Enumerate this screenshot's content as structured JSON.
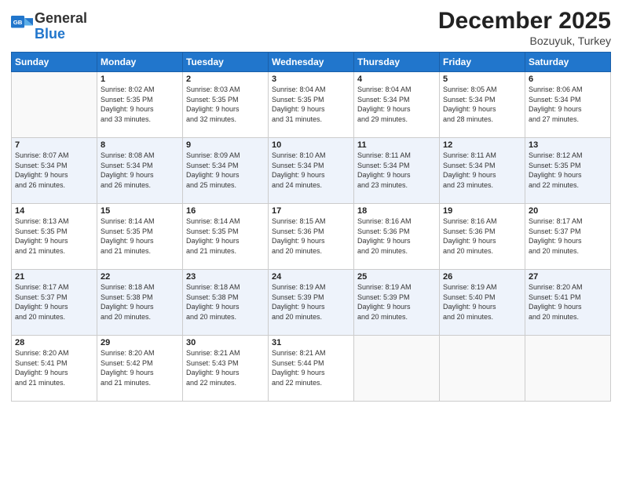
{
  "header": {
    "logo_general": "General",
    "logo_blue": "Blue",
    "month": "December 2025",
    "location": "Bozuyuk, Turkey"
  },
  "days_of_week": [
    "Sunday",
    "Monday",
    "Tuesday",
    "Wednesday",
    "Thursday",
    "Friday",
    "Saturday"
  ],
  "weeks": [
    [
      {
        "day": "",
        "sunrise": "",
        "sunset": "",
        "daylight": ""
      },
      {
        "day": "1",
        "sunrise": "Sunrise: 8:02 AM",
        "sunset": "Sunset: 5:35 PM",
        "daylight": "Daylight: 9 hours and 33 minutes."
      },
      {
        "day": "2",
        "sunrise": "Sunrise: 8:03 AM",
        "sunset": "Sunset: 5:35 PM",
        "daylight": "Daylight: 9 hours and 32 minutes."
      },
      {
        "day": "3",
        "sunrise": "Sunrise: 8:04 AM",
        "sunset": "Sunset: 5:35 PM",
        "daylight": "Daylight: 9 hours and 31 minutes."
      },
      {
        "day": "4",
        "sunrise": "Sunrise: 8:04 AM",
        "sunset": "Sunset: 5:34 PM",
        "daylight": "Daylight: 9 hours and 29 minutes."
      },
      {
        "day": "5",
        "sunrise": "Sunrise: 8:05 AM",
        "sunset": "Sunset: 5:34 PM",
        "daylight": "Daylight: 9 hours and 28 minutes."
      },
      {
        "day": "6",
        "sunrise": "Sunrise: 8:06 AM",
        "sunset": "Sunset: 5:34 PM",
        "daylight": "Daylight: 9 hours and 27 minutes."
      }
    ],
    [
      {
        "day": "7",
        "sunrise": "Sunrise: 8:07 AM",
        "sunset": "Sunset: 5:34 PM",
        "daylight": "Daylight: 9 hours and 26 minutes."
      },
      {
        "day": "8",
        "sunrise": "Sunrise: 8:08 AM",
        "sunset": "Sunset: 5:34 PM",
        "daylight": "Daylight: 9 hours and 26 minutes."
      },
      {
        "day": "9",
        "sunrise": "Sunrise: 8:09 AM",
        "sunset": "Sunset: 5:34 PM",
        "daylight": "Daylight: 9 hours and 25 minutes."
      },
      {
        "day": "10",
        "sunrise": "Sunrise: 8:10 AM",
        "sunset": "Sunset: 5:34 PM",
        "daylight": "Daylight: 9 hours and 24 minutes."
      },
      {
        "day": "11",
        "sunrise": "Sunrise: 8:11 AM",
        "sunset": "Sunset: 5:34 PM",
        "daylight": "Daylight: 9 hours and 23 minutes."
      },
      {
        "day": "12",
        "sunrise": "Sunrise: 8:11 AM",
        "sunset": "Sunset: 5:34 PM",
        "daylight": "Daylight: 9 hours and 23 minutes."
      },
      {
        "day": "13",
        "sunrise": "Sunrise: 8:12 AM",
        "sunset": "Sunset: 5:35 PM",
        "daylight": "Daylight: 9 hours and 22 minutes."
      }
    ],
    [
      {
        "day": "14",
        "sunrise": "Sunrise: 8:13 AM",
        "sunset": "Sunset: 5:35 PM",
        "daylight": "Daylight: 9 hours and 21 minutes."
      },
      {
        "day": "15",
        "sunrise": "Sunrise: 8:14 AM",
        "sunset": "Sunset: 5:35 PM",
        "daylight": "Daylight: 9 hours and 21 minutes."
      },
      {
        "day": "16",
        "sunrise": "Sunrise: 8:14 AM",
        "sunset": "Sunset: 5:35 PM",
        "daylight": "Daylight: 9 hours and 21 minutes."
      },
      {
        "day": "17",
        "sunrise": "Sunrise: 8:15 AM",
        "sunset": "Sunset: 5:36 PM",
        "daylight": "Daylight: 9 hours and 20 minutes."
      },
      {
        "day": "18",
        "sunrise": "Sunrise: 8:16 AM",
        "sunset": "Sunset: 5:36 PM",
        "daylight": "Daylight: 9 hours and 20 minutes."
      },
      {
        "day": "19",
        "sunrise": "Sunrise: 8:16 AM",
        "sunset": "Sunset: 5:36 PM",
        "daylight": "Daylight: 9 hours and 20 minutes."
      },
      {
        "day": "20",
        "sunrise": "Sunrise: 8:17 AM",
        "sunset": "Sunset: 5:37 PM",
        "daylight": "Daylight: 9 hours and 20 minutes."
      }
    ],
    [
      {
        "day": "21",
        "sunrise": "Sunrise: 8:17 AM",
        "sunset": "Sunset: 5:37 PM",
        "daylight": "Daylight: 9 hours and 20 minutes."
      },
      {
        "day": "22",
        "sunrise": "Sunrise: 8:18 AM",
        "sunset": "Sunset: 5:38 PM",
        "daylight": "Daylight: 9 hours and 20 minutes."
      },
      {
        "day": "23",
        "sunrise": "Sunrise: 8:18 AM",
        "sunset": "Sunset: 5:38 PM",
        "daylight": "Daylight: 9 hours and 20 minutes."
      },
      {
        "day": "24",
        "sunrise": "Sunrise: 8:19 AM",
        "sunset": "Sunset: 5:39 PM",
        "daylight": "Daylight: 9 hours and 20 minutes."
      },
      {
        "day": "25",
        "sunrise": "Sunrise: 8:19 AM",
        "sunset": "Sunset: 5:39 PM",
        "daylight": "Daylight: 9 hours and 20 minutes."
      },
      {
        "day": "26",
        "sunrise": "Sunrise: 8:19 AM",
        "sunset": "Sunset: 5:40 PM",
        "daylight": "Daylight: 9 hours and 20 minutes."
      },
      {
        "day": "27",
        "sunrise": "Sunrise: 8:20 AM",
        "sunset": "Sunset: 5:41 PM",
        "daylight": "Daylight: 9 hours and 20 minutes."
      }
    ],
    [
      {
        "day": "28",
        "sunrise": "Sunrise: 8:20 AM",
        "sunset": "Sunset: 5:41 PM",
        "daylight": "Daylight: 9 hours and 21 minutes."
      },
      {
        "day": "29",
        "sunrise": "Sunrise: 8:20 AM",
        "sunset": "Sunset: 5:42 PM",
        "daylight": "Daylight: 9 hours and 21 minutes."
      },
      {
        "day": "30",
        "sunrise": "Sunrise: 8:21 AM",
        "sunset": "Sunset: 5:43 PM",
        "daylight": "Daylight: 9 hours and 22 minutes."
      },
      {
        "day": "31",
        "sunrise": "Sunrise: 8:21 AM",
        "sunset": "Sunset: 5:44 PM",
        "daylight": "Daylight: 9 hours and 22 minutes."
      },
      {
        "day": "",
        "sunrise": "",
        "sunset": "",
        "daylight": ""
      },
      {
        "day": "",
        "sunrise": "",
        "sunset": "",
        "daylight": ""
      },
      {
        "day": "",
        "sunrise": "",
        "sunset": "",
        "daylight": ""
      }
    ]
  ]
}
